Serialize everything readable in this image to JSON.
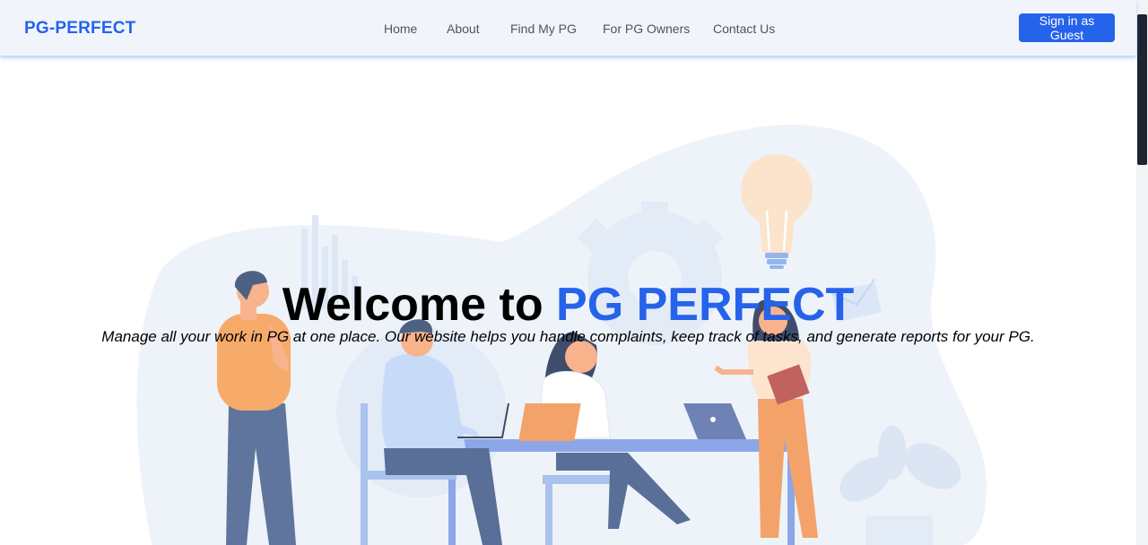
{
  "navbar": {
    "brand": "PG-PERFECT",
    "links": [
      "Home",
      "About",
      "Find My PG",
      "For PG Owners",
      "Contact Us"
    ],
    "signin_label": "Sign in as Guest"
  },
  "hero": {
    "title_prefix": "Welcome to",
    "title_accent": "PG PERFECT",
    "subtitle": "Manage all your work in PG at one place. Our website helps you handle complaints, keep track of tasks, and generate reports for your PG."
  },
  "colors": {
    "brand": "#2563eb",
    "navbar_bg": "#f1f5fb",
    "text_dark": "#000000",
    "nav_text": "#4b5563"
  }
}
